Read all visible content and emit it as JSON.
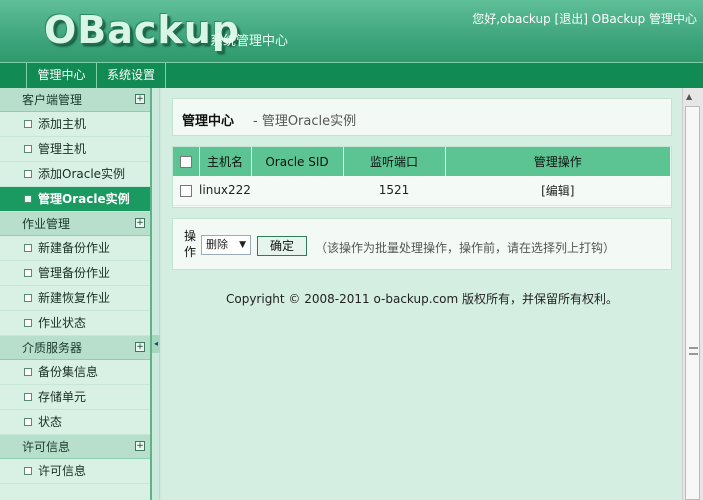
{
  "header": {
    "logo": "OBackup",
    "system_title": "系统管理中心",
    "greeting": "您好,obackup",
    "logout": "[退出]",
    "app_name": "OBackup 管理中心"
  },
  "topnav": [
    {
      "label": "管理中心"
    },
    {
      "label": "系统设置"
    }
  ],
  "sidebar": {
    "sections": [
      {
        "title": "客户端管理",
        "items": [
          "添加主机",
          "管理主机",
          "添加Oracle实例",
          "管理Oracle实例"
        ]
      },
      {
        "title": "作业管理",
        "items": [
          "新建备份作业",
          "管理备份作业",
          "新建恢复作业",
          "作业状态"
        ]
      },
      {
        "title": "介质服务器",
        "items": [
          "备份集信息",
          "存储单元",
          "状态"
        ]
      },
      {
        "title": "许可信息",
        "items": [
          "许可信息"
        ]
      }
    ],
    "active_item": "管理Oracle实例"
  },
  "page": {
    "title": "管理中心",
    "separator": " - ",
    "subtitle": "管理Oracle实例"
  },
  "table": {
    "headers": [
      "主机名",
      "Oracle SID",
      "监听端口",
      "管理操作"
    ],
    "rows": [
      {
        "host": "linux222",
        "sid": "",
        "port": "1521",
        "action": "[编辑]"
      }
    ]
  },
  "operation": {
    "label": "操作",
    "selected": "删除",
    "confirm": "确定",
    "note": "（该操作为批量处理操作，操作前，请在选择列上打钩）"
  },
  "footer": {
    "copyright": "Copyright © 2008-2011 o-backup.com 版权所有，并保留所有权利。"
  }
}
